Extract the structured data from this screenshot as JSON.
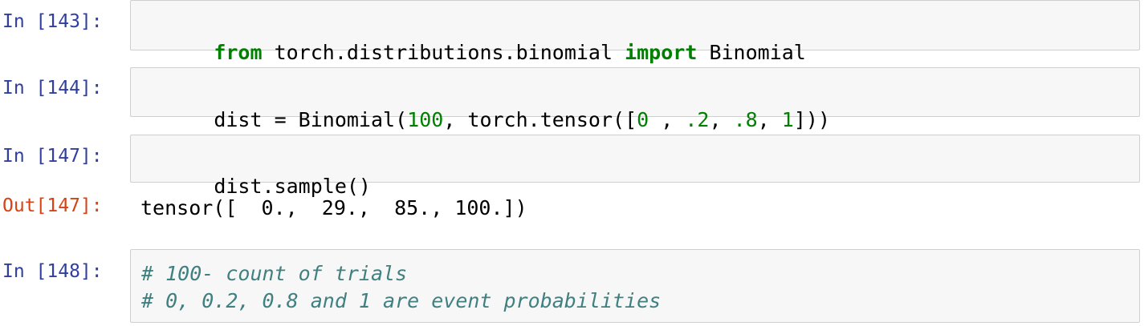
{
  "cells": [
    {
      "prompt": "In [143]:",
      "code_parts": [
        {
          "t": "from",
          "c": "kw"
        },
        {
          "t": " torch.distributions.binomial ",
          "c": ""
        },
        {
          "t": "import",
          "c": "kw"
        },
        {
          "t": " Binomial",
          "c": ""
        }
      ]
    },
    {
      "prompt": "In [144]:",
      "code_parts": [
        {
          "t": "dist = Binomial(",
          "c": ""
        },
        {
          "t": "100",
          "c": "num"
        },
        {
          "t": ", torch.tensor([",
          "c": ""
        },
        {
          "t": "0",
          "c": "num"
        },
        {
          "t": " , ",
          "c": ""
        },
        {
          "t": ".2",
          "c": "num"
        },
        {
          "t": ", ",
          "c": ""
        },
        {
          "t": ".8",
          "c": "num"
        },
        {
          "t": ", ",
          "c": ""
        },
        {
          "t": "1",
          "c": "num"
        },
        {
          "t": "]))",
          "c": ""
        }
      ]
    },
    {
      "prompt": "In [147]:",
      "code_parts": [
        {
          "t": "dist.sample()",
          "c": ""
        }
      ],
      "out_prompt": "Out[147]:",
      "output": "tensor([  0.,  29.,  85., 100.])"
    },
    {
      "prompt": "In [148]:",
      "comment_lines": [
        "# 100- count of trials",
        "# 0, 0.2, 0.8 and 1 are event probabilities"
      ]
    }
  ]
}
